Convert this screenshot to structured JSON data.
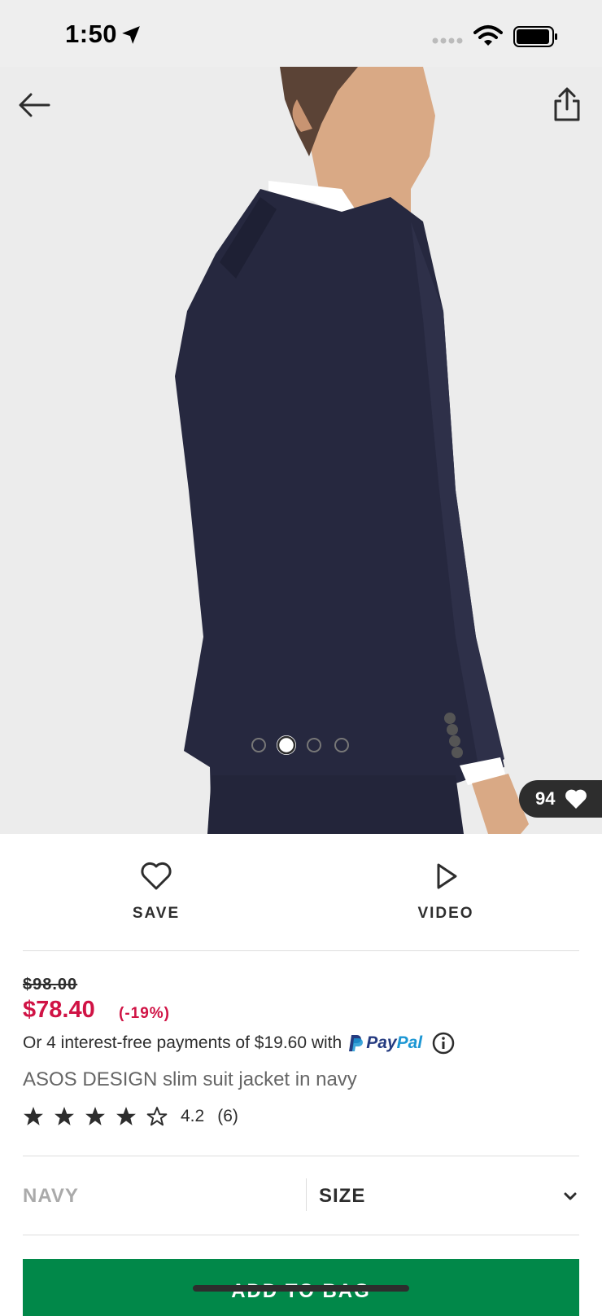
{
  "status_bar": {
    "time": "1:50"
  },
  "gallery": {
    "likes_count": "94",
    "current_index": 1,
    "total": 4
  },
  "actions": {
    "save_label": "SAVE",
    "video_label": "VIDEO"
  },
  "pricing": {
    "original": "$98.00",
    "current": "$78.40",
    "discount": "(-19%)",
    "installments_text": "Or 4 interest-free payments of $19.60 with",
    "paypal_label_p1": "Pay",
    "paypal_label_p2": "Pal"
  },
  "product": {
    "name": "ASOS DESIGN slim suit jacket in navy",
    "rating_value": "4.2",
    "rating_count": "(6)",
    "stars_filled": 4,
    "stars_total": 5
  },
  "selectors": {
    "color": "NAVY",
    "size": "SIZE"
  },
  "cta": {
    "add_to_bag": "ADD TO BAG"
  },
  "colors": {
    "price_red": "#d01345",
    "button_green": "#018849",
    "suit_navy": "#26283f"
  }
}
